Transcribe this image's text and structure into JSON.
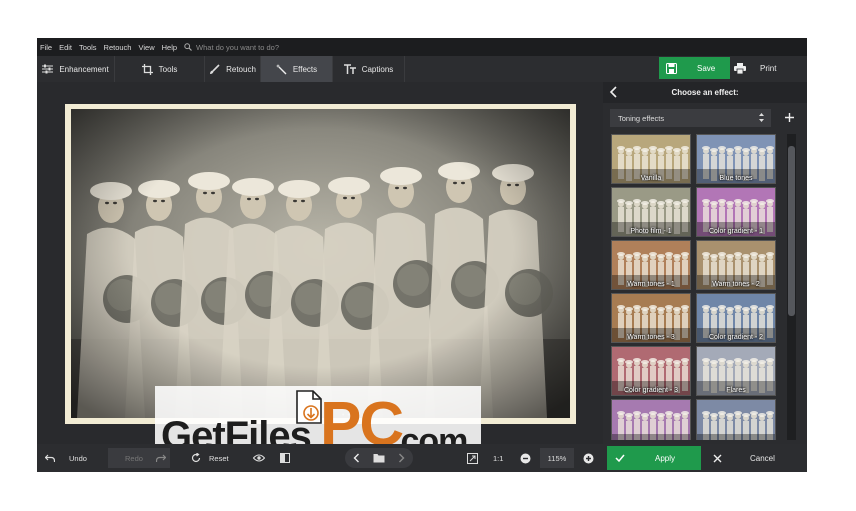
{
  "menu": {
    "items": [
      "File",
      "Edit",
      "Tools",
      "Retouch",
      "View",
      "Help"
    ],
    "search_placeholder": "What do you want to do?"
  },
  "toolbar": {
    "tabs": [
      {
        "label": "Enhancement",
        "icon": "sliders-icon"
      },
      {
        "label": "Tools",
        "icon": "crop-icon"
      },
      {
        "label": "Retouch",
        "icon": "brush-icon"
      },
      {
        "label": "Effects",
        "icon": "magic-wand-icon",
        "active": true
      },
      {
        "label": "Captions",
        "icon": "text-icon"
      }
    ],
    "save_label": "Save",
    "print_label": "Print"
  },
  "panel": {
    "title": "Choose an effect:",
    "category": "Toning effects",
    "effects": [
      {
        "label": "Vanilla",
        "tint": "#b8a77c"
      },
      {
        "label": "Blue tones",
        "tint": "#7f93b5"
      },
      {
        "label": "Photo film - 1",
        "tint": "#9a9a86"
      },
      {
        "label": "Color gradient - 1",
        "tint": "#b276b6"
      },
      {
        "label": "Warm tones - 1",
        "tint": "#b0805a"
      },
      {
        "label": "Warm tones - 2",
        "tint": "#a9916e"
      },
      {
        "label": "Warm tones - 3",
        "tint": "#a77c52"
      },
      {
        "label": "Color gradient - 2",
        "tint": "#6f86a8"
      },
      {
        "label": "Color gradient - 3",
        "tint": "#b06a72"
      },
      {
        "label": "Flares",
        "tint": "#a4aab8"
      },
      {
        "label": "",
        "tint": "#a67ab0"
      },
      {
        "label": "",
        "tint": "#7d8aa5"
      }
    ]
  },
  "watermark": {
    "part1": "GetFiles",
    "part2": "PC",
    "part3": ".com"
  },
  "bottom": {
    "undo_label": "Undo",
    "redo_label": "Redo",
    "reset_label": "Reset",
    "ratio_label": "1:1",
    "zoom_value": "115%",
    "apply_label": "Apply",
    "cancel_label": "Cancel"
  },
  "colors": {
    "accent_green": "#1f9a4c",
    "watermark_orange": "#d9741e"
  }
}
